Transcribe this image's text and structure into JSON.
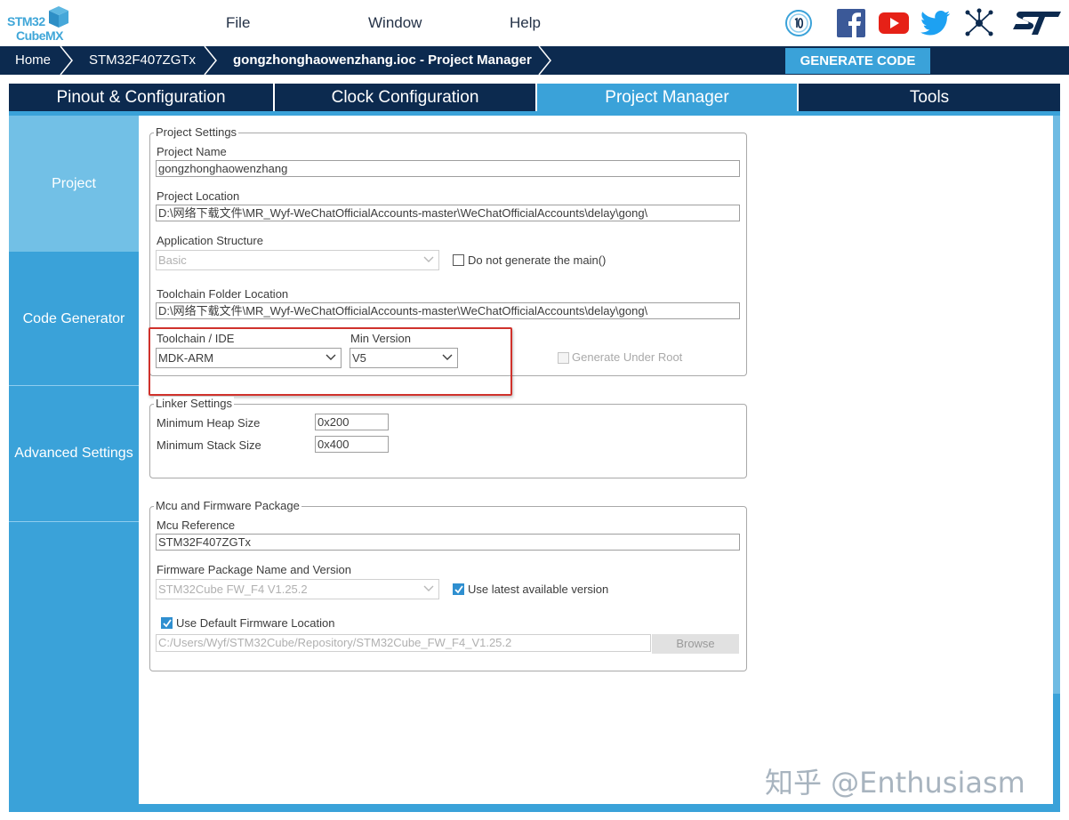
{
  "app": {
    "logo_line1": "STM32",
    "logo_line2": "CubeMX",
    "menu": [
      "File",
      "Window",
      "Help"
    ]
  },
  "breadcrumb": {
    "items": [
      "Home",
      "STM32F407ZGTx",
      "gongzhonghaowenzhang.ioc - Project Manager"
    ],
    "generate_label": "GENERATE CODE"
  },
  "tabs": [
    {
      "label": "Pinout & Configuration",
      "active": false
    },
    {
      "label": "Clock Configuration",
      "active": false
    },
    {
      "label": "Project Manager",
      "active": true
    },
    {
      "label": "Tools",
      "active": false
    }
  ],
  "sidebar": {
    "items": [
      {
        "label": "Project",
        "active": true
      },
      {
        "label": "Code Generator",
        "active": false
      },
      {
        "label": "Advanced Settings",
        "active": false
      }
    ]
  },
  "project_settings": {
    "legend": "Project Settings",
    "project_name_label": "Project Name",
    "project_name_value": "gongzhonghaowenzhang",
    "project_location_label": "Project Location",
    "project_location_value": "D:\\网络下载文件\\MR_Wyf-WeChatOfficialAccounts-master\\WeChatOfficialAccounts\\delay\\gong\\",
    "app_structure_label": "Application Structure",
    "app_structure_value": "Basic",
    "no_main_label": "Do not generate the main()",
    "no_main_checked": false,
    "toolchain_folder_label": "Toolchain Folder Location",
    "toolchain_folder_value": "D:\\网络下载文件\\MR_Wyf-WeChatOfficialAccounts-master\\WeChatOfficialAccounts\\delay\\gong\\",
    "toolchain_label": "Toolchain / IDE",
    "toolchain_value": "MDK-ARM",
    "min_version_label": "Min Version",
    "min_version_value": "V5",
    "generate_under_root_label": "Generate Under Root",
    "generate_under_root_checked": false
  },
  "linker_settings": {
    "legend": "Linker Settings",
    "heap_label": "Minimum Heap Size",
    "heap_value": "0x200",
    "stack_label": "Minimum Stack Size",
    "stack_value": "0x400"
  },
  "mcu_firmware": {
    "legend": "Mcu and Firmware Package",
    "mcu_ref_label": "Mcu Reference",
    "mcu_ref_value": "STM32F407ZGTx",
    "fw_name_label": "Firmware Package Name and Version",
    "fw_name_value": "STM32Cube FW_F4 V1.25.2",
    "use_latest_label": "Use latest available version",
    "use_latest_checked": true,
    "use_default_label": "Use Default Firmware Location",
    "use_default_checked": true,
    "fw_path_value": "C:/Users/Wyf/STM32Cube/Repository/STM32Cube_FW_F4_V1.25.2",
    "browse_label": "Browse"
  },
  "watermark": "知乎 @Enthusiasm",
  "colors": {
    "navy": "#0c2a4f",
    "accent": "#3aa2d9",
    "sidebar_active": "#72c0e6",
    "highlight": "#d0322c"
  },
  "icons": [
    "cube-icon",
    "anniversary-badge-icon",
    "facebook-icon",
    "youtube-icon",
    "twitter-icon",
    "network-icon",
    "st-logo-icon"
  ]
}
